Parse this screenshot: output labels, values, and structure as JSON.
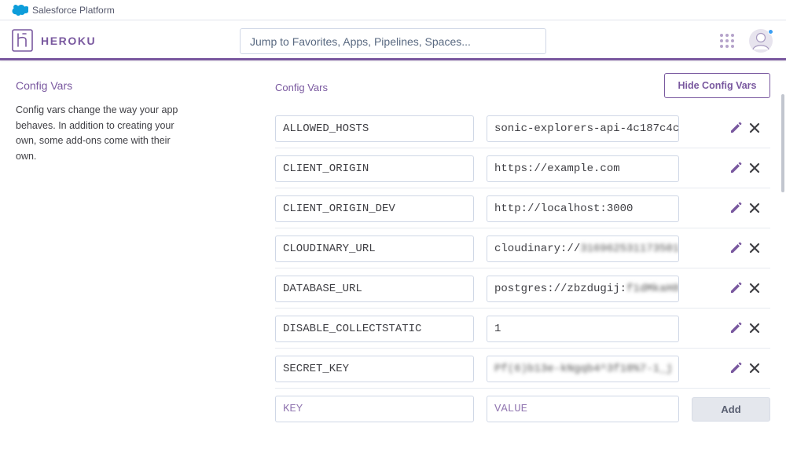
{
  "salesforce_bar": {
    "label": "Salesforce Platform",
    "logo_icon": "salesforce-cloud-icon"
  },
  "header": {
    "brand": "HEROKU",
    "brand_color": "#79589f",
    "search_placeholder": "Jump to Favorites, Apps, Pipelines, Spaces...",
    "apps_icon": "grid-dots-icon",
    "avatar_icon": "user-avatar-icon",
    "notification_dot_color": "#3b9ff3"
  },
  "info": {
    "title": "Config Vars",
    "description": "Config vars change the way your app behaves. In addition to creating your own, some add-ons come with their own."
  },
  "panel": {
    "label": "Config Vars",
    "hide_button": "Hide Config Vars",
    "vars": [
      {
        "key": "ALLOWED_HOSTS",
        "value": "sonic-explorers-api-4c187c4c",
        "value_masked": ""
      },
      {
        "key": "CLIENT_ORIGIN",
        "value": "https://example.com",
        "value_masked": ""
      },
      {
        "key": "CLIENT_ORIGIN_DEV",
        "value": "http://localhost:3000",
        "value_masked": ""
      },
      {
        "key": "CLOUDINARY_URL",
        "value": "cloudinary://",
        "value_masked": "316962531173501"
      },
      {
        "key": "DATABASE_URL",
        "value": "postgres://zbzdugij:",
        "value_masked": "f1dMkaH8"
      },
      {
        "key": "DISABLE_COLLECTSTATIC",
        "value": "1",
        "value_masked": ""
      },
      {
        "key": "SECRET_KEY",
        "value": "",
        "value_masked": "Pf(6)b13e-kNgqb4^3f10%7-1_j"
      }
    ],
    "new_key_placeholder": "KEY",
    "new_value_placeholder": "VALUE",
    "add_button": "Add"
  }
}
